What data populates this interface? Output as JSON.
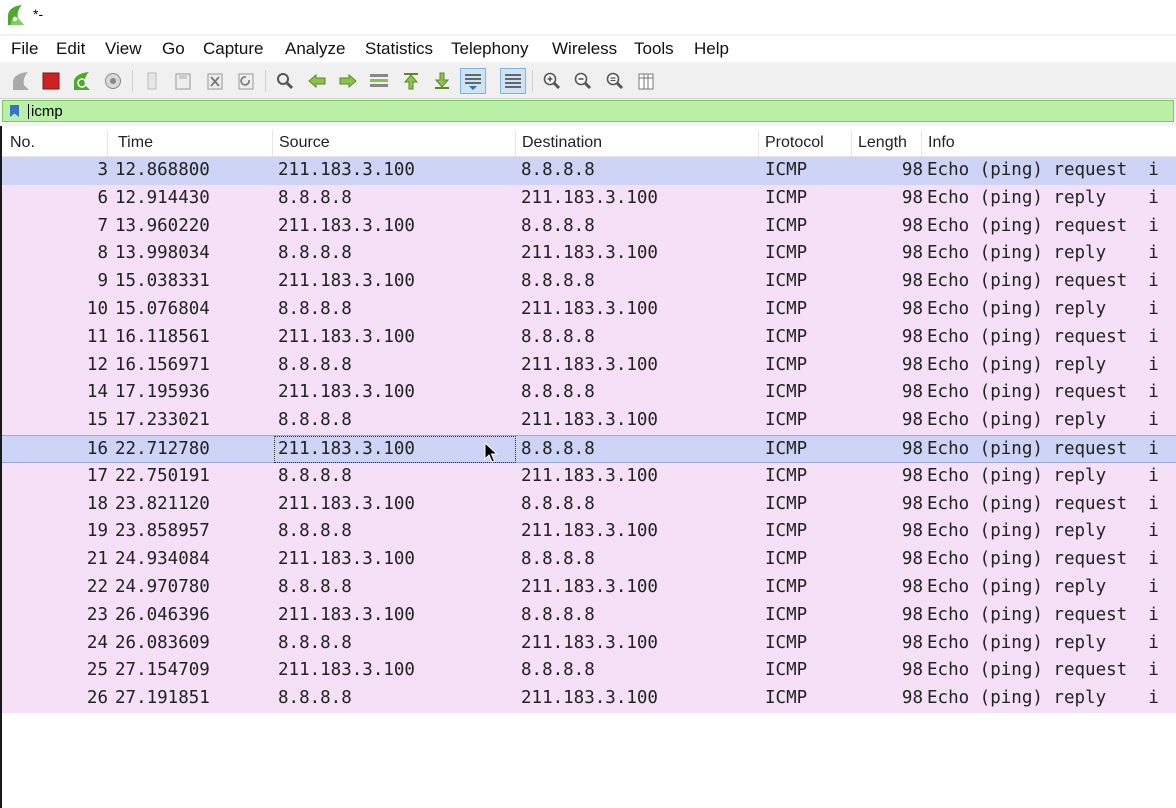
{
  "window": {
    "title": "*-"
  },
  "menu": [
    "File",
    "Edit",
    "View",
    "Go",
    "Capture",
    "Analyze",
    "Statistics",
    "Telephony",
    "Wireless",
    "Tools",
    "Help"
  ],
  "toolbar": {
    "buttons": [
      "start-capture-icon",
      "stop-capture-icon",
      "restart-capture-icon",
      "capture-options-icon",
      "open-file-icon",
      "save-file-icon",
      "close-file-icon",
      "reload-file-icon",
      "find-packet-icon",
      "go-back-icon",
      "go-forward-icon",
      "go-to-packet-icon",
      "go-first-icon",
      "go-last-icon",
      "autoscroll-icon",
      "colorize-icon",
      "zoom-in-icon",
      "zoom-out-icon",
      "zoom-normal-icon",
      "resize-columns-icon"
    ],
    "colors": {
      "stop": "#cc2222",
      "accent_green": "#4caa2a"
    }
  },
  "filter": {
    "value": "icmp",
    "background": "#b8f0a6"
  },
  "columns": {
    "no": "No.",
    "time": "Time",
    "source": "Source",
    "destination": "Destination",
    "protocol": "Protocol",
    "length": "Length",
    "info": "Info"
  },
  "rows": [
    {
      "no": "3",
      "time": "12.868800",
      "src": "211.183.3.100",
      "dst": "8.8.8.8",
      "proto": "ICMP",
      "len": "98",
      "info": "Echo (ping) request  i"
    },
    {
      "no": "6",
      "time": "12.914430",
      "src": "8.8.8.8",
      "dst": "211.183.3.100",
      "proto": "ICMP",
      "len": "98",
      "info": "Echo (ping) reply    i"
    },
    {
      "no": "7",
      "time": "13.960220",
      "src": "211.183.3.100",
      "dst": "8.8.8.8",
      "proto": "ICMP",
      "len": "98",
      "info": "Echo (ping) request  i"
    },
    {
      "no": "8",
      "time": "13.998034",
      "src": "8.8.8.8",
      "dst": "211.183.3.100",
      "proto": "ICMP",
      "len": "98",
      "info": "Echo (ping) reply    i"
    },
    {
      "no": "9",
      "time": "15.038331",
      "src": "211.183.3.100",
      "dst": "8.8.8.8",
      "proto": "ICMP",
      "len": "98",
      "info": "Echo (ping) request  i"
    },
    {
      "no": "10",
      "time": "15.076804",
      "src": "8.8.8.8",
      "dst": "211.183.3.100",
      "proto": "ICMP",
      "len": "98",
      "info": "Echo (ping) reply    i"
    },
    {
      "no": "11",
      "time": "16.118561",
      "src": "211.183.3.100",
      "dst": "8.8.8.8",
      "proto": "ICMP",
      "len": "98",
      "info": "Echo (ping) request  i"
    },
    {
      "no": "12",
      "time": "16.156971",
      "src": "8.8.8.8",
      "dst": "211.183.3.100",
      "proto": "ICMP",
      "len": "98",
      "info": "Echo (ping) reply    i"
    },
    {
      "no": "14",
      "time": "17.195936",
      "src": "211.183.3.100",
      "dst": "8.8.8.8",
      "proto": "ICMP",
      "len": "98",
      "info": "Echo (ping) request  i"
    },
    {
      "no": "15",
      "time": "17.233021",
      "src": "8.8.8.8",
      "dst": "211.183.3.100",
      "proto": "ICMP",
      "len": "98",
      "info": "Echo (ping) reply    i"
    },
    {
      "no": "16",
      "time": "22.712780",
      "src": "211.183.3.100",
      "dst": "8.8.8.8",
      "proto": "ICMP",
      "len": "98",
      "info": "Echo (ping) request  i"
    },
    {
      "no": "17",
      "time": "22.750191",
      "src": "8.8.8.8",
      "dst": "211.183.3.100",
      "proto": "ICMP",
      "len": "98",
      "info": "Echo (ping) reply    i"
    },
    {
      "no": "18",
      "time": "23.821120",
      "src": "211.183.3.100",
      "dst": "8.8.8.8",
      "proto": "ICMP",
      "len": "98",
      "info": "Echo (ping) request  i"
    },
    {
      "no": "19",
      "time": "23.858957",
      "src": "8.8.8.8",
      "dst": "211.183.3.100",
      "proto": "ICMP",
      "len": "98",
      "info": "Echo (ping) reply    i"
    },
    {
      "no": "21",
      "time": "24.934084",
      "src": "211.183.3.100",
      "dst": "8.8.8.8",
      "proto": "ICMP",
      "len": "98",
      "info": "Echo (ping) request  i"
    },
    {
      "no": "22",
      "time": "24.970780",
      "src": "8.8.8.8",
      "dst": "211.183.3.100",
      "proto": "ICMP",
      "len": "98",
      "info": "Echo (ping) reply    i"
    },
    {
      "no": "23",
      "time": "26.046396",
      "src": "211.183.3.100",
      "dst": "8.8.8.8",
      "proto": "ICMP",
      "len": "98",
      "info": "Echo (ping) request  i"
    },
    {
      "no": "24",
      "time": "26.083609",
      "src": "8.8.8.8",
      "dst": "211.183.3.100",
      "proto": "ICMP",
      "len": "98",
      "info": "Echo (ping) reply    i"
    },
    {
      "no": "25",
      "time": "27.154709",
      "src": "211.183.3.100",
      "dst": "8.8.8.8",
      "proto": "ICMP",
      "len": "98",
      "info": "Echo (ping) request  i"
    },
    {
      "no": "26",
      "time": "27.191851",
      "src": "8.8.8.8",
      "dst": "211.183.3.100",
      "proto": "ICMP",
      "len": "98",
      "info": "Echo (ping) reply    i"
    }
  ],
  "row_colors": {
    "icmp": "#f5e0f7",
    "highlight": "#cdd4f5"
  }
}
